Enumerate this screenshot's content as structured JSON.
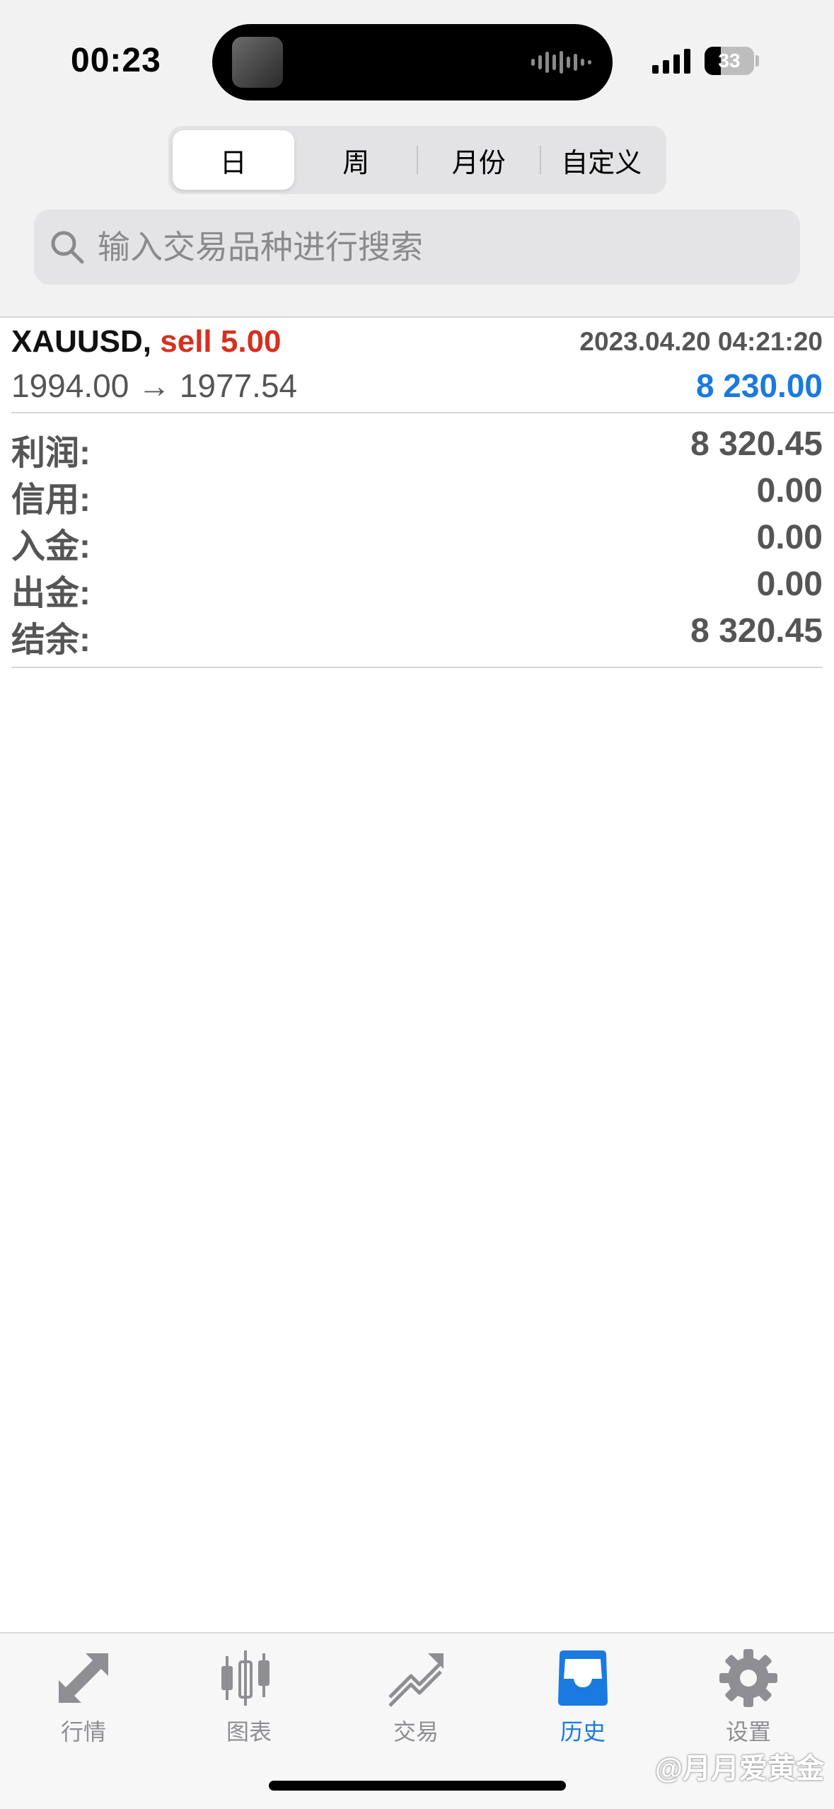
{
  "status_bar": {
    "time": "00:23",
    "battery": "33",
    "battery_level": 0.33
  },
  "period_tabs": [
    {
      "label": "日",
      "active": true
    },
    {
      "label": "周",
      "active": false
    },
    {
      "label": "月份",
      "active": false
    },
    {
      "label": "自定义",
      "active": false
    }
  ],
  "search": {
    "placeholder": "输入交易品种进行搜索",
    "value": ""
  },
  "deal": {
    "symbol": "XAUUSD,",
    "side": "sell 5.00",
    "time": "2023.04.20 04:21:20",
    "prices": "1994.00 → 1977.54",
    "profit": "8 230.00"
  },
  "summary": [
    {
      "label": "利润:",
      "value": "8 320.45"
    },
    {
      "label": "信用:",
      "value": "0.00"
    },
    {
      "label": "入金:",
      "value": "0.00"
    },
    {
      "label": "出金:",
      "value": "0.00"
    },
    {
      "label": "结余:",
      "value": "8 320.45"
    }
  ],
  "tabbar": [
    {
      "label": "行情",
      "icon": "quotes-arrows-icon",
      "active": false
    },
    {
      "label": "图表",
      "icon": "candlestick-chart-icon",
      "active": false
    },
    {
      "label": "交易",
      "icon": "trade-trend-icon",
      "active": false
    },
    {
      "label": "历史",
      "icon": "history-inbox-icon",
      "active": true
    },
    {
      "label": "设置",
      "icon": "gear-icon",
      "active": false
    }
  ],
  "watermark": "@月月爱黄金",
  "colors": {
    "accent": "#1a7ae0",
    "sell": "#d6301f",
    "muted": "#555555"
  }
}
